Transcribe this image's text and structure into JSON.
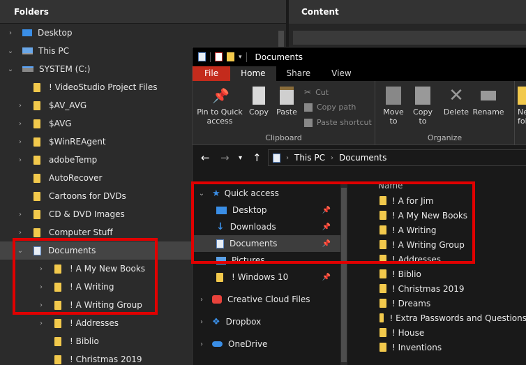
{
  "background_app": {
    "folders_header": "Folders",
    "content_header": "Content",
    "tree": [
      {
        "label": "Desktop",
        "icon": "desktop-icon",
        "indent": 0,
        "expander": "right"
      },
      {
        "label": "This PC",
        "icon": "pc-icon",
        "indent": 0,
        "expander": "down"
      },
      {
        "label": "SYSTEM (C:)",
        "icon": "drive-icon",
        "indent": 1,
        "expander": "down"
      },
      {
        "label": "! VideoStudio Project Files",
        "icon": "folder-icon",
        "indent": 2,
        "expander": ""
      },
      {
        "label": "$AV_AVG",
        "icon": "folder-icon",
        "indent": 2,
        "expander": "right"
      },
      {
        "label": "$AVG",
        "icon": "folder-icon",
        "indent": 2,
        "expander": "right"
      },
      {
        "label": "$WinREAgent",
        "icon": "folder-icon",
        "indent": 2,
        "expander": "right"
      },
      {
        "label": "adobeTemp",
        "icon": "folder-icon",
        "indent": 2,
        "expander": "right"
      },
      {
        "label": "AutoRecover",
        "icon": "folder-icon",
        "indent": 2,
        "expander": ""
      },
      {
        "label": "Cartoons for DVDs",
        "icon": "folder-icon",
        "indent": 2,
        "expander": ""
      },
      {
        "label": "CD & DVD Images",
        "icon": "folder-icon",
        "indent": 2,
        "expander": "right"
      },
      {
        "label": "Computer Stuff",
        "icon": "folder-icon",
        "indent": 2,
        "expander": "right"
      },
      {
        "label": "Documents",
        "icon": "documents-icon",
        "indent": 2,
        "expander": "down",
        "selected": true
      },
      {
        "label": "! A My New Books",
        "icon": "folder-icon",
        "indent": 3,
        "expander": "right"
      },
      {
        "label": "! A Writing",
        "icon": "folder-icon",
        "indent": 3,
        "expander": "right"
      },
      {
        "label": "! A Writing Group",
        "icon": "folder-icon",
        "indent": 3,
        "expander": "right"
      },
      {
        "label": "! Addresses",
        "icon": "folder-icon",
        "indent": 3,
        "expander": "right"
      },
      {
        "label": "! Biblio",
        "icon": "folder-icon",
        "indent": 3,
        "expander": ""
      },
      {
        "label": "! Christmas 2019",
        "icon": "folder-icon",
        "indent": 3,
        "expander": ""
      }
    ]
  },
  "explorer": {
    "window_title": "Documents",
    "ribbon_tabs": [
      "File",
      "Home",
      "Share",
      "View"
    ],
    "clipboard": {
      "group_label": "Clipboard",
      "pin_label_1": "Pin to Quick",
      "pin_label_2": "access",
      "copy": "Copy",
      "paste": "Paste",
      "cut": "Cut",
      "copy_path": "Copy path",
      "paste_shortcut": "Paste shortcut"
    },
    "organize": {
      "group_label": "Organize",
      "move_to_1": "Move",
      "move_to_2": "to",
      "copy_to_1": "Copy",
      "copy_to_2": "to",
      "delete": "Delete",
      "rename": "Rename",
      "new_folder_1": "Ne",
      "new_folder_2": "fold"
    },
    "address": {
      "segment_1": "This PC",
      "segment_2": "Documents"
    },
    "nav_items": [
      {
        "label": "Quick access",
        "icon": "quick-access-star-icon",
        "expander": "down",
        "indent": 0
      },
      {
        "label": "Desktop",
        "icon": "desktop-icon",
        "pinned": true,
        "indent": 1
      },
      {
        "label": "Downloads",
        "icon": "downloads-icon",
        "pinned": true,
        "indent": 1
      },
      {
        "label": "Documents",
        "icon": "documents-icon",
        "pinned": true,
        "indent": 1,
        "selected": true
      },
      {
        "label": "Pictures",
        "icon": "pictures-icon",
        "pinned": false,
        "indent": 1
      },
      {
        "label": "! Windows 10",
        "icon": "folder-icon",
        "pinned": true,
        "indent": 1
      },
      {
        "label": "Creative Cloud Files",
        "icon": "creative-cloud-icon",
        "expander": "right",
        "indent": 0
      },
      {
        "label": "Dropbox",
        "icon": "dropbox-icon",
        "expander": "right",
        "indent": 0
      },
      {
        "label": "OneDrive",
        "icon": "onedrive-icon",
        "expander": "right",
        "indent": 0
      }
    ],
    "file_column_header": "Name",
    "files": [
      "! A for Jim",
      "! A My New Books",
      "! A Writing",
      "! A Writing Group",
      "! Addresses",
      "! Biblio",
      "! Christmas 2019",
      "! Dreams",
      "! Extra Passwords and Questions",
      "! House",
      "! Inventions"
    ]
  },
  "highlight_color": "#e00000",
  "folder_color": "#f2c94c",
  "accent_color": "#3a8ee6"
}
